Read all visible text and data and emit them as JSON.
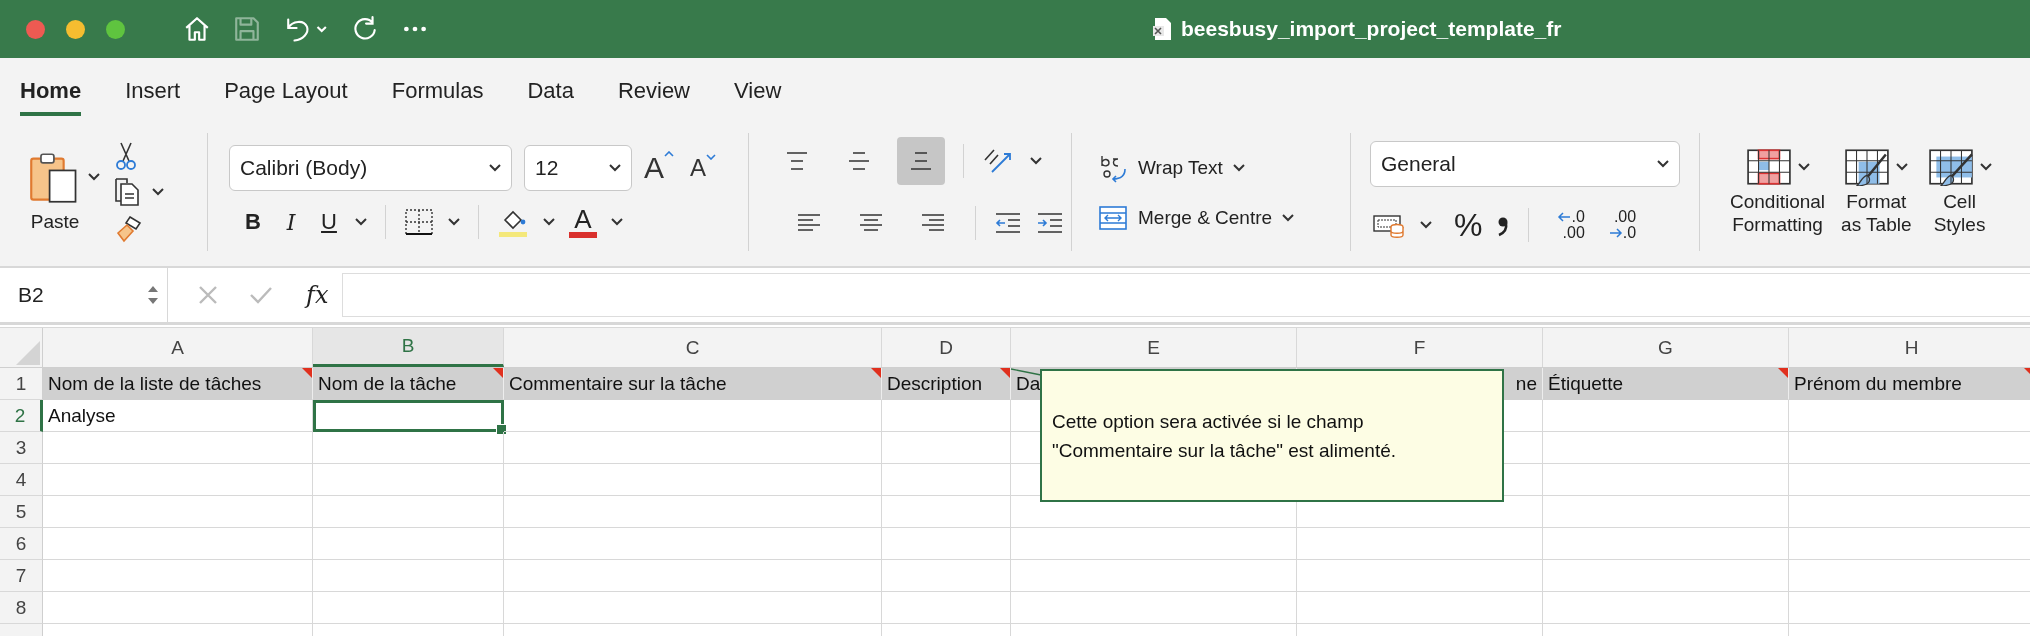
{
  "window": {
    "title": "beesbusy_import_project_template_fr"
  },
  "quick_access": [
    {
      "kind": "home",
      "disabled": false
    },
    {
      "kind": "save",
      "disabled": true
    },
    {
      "kind": "undo",
      "disabled": false
    },
    {
      "kind": "redo",
      "disabled": false
    },
    {
      "kind": "more",
      "disabled": false
    }
  ],
  "ribbon_tabs": [
    {
      "label": "Home",
      "selected": true
    },
    {
      "label": "Insert",
      "selected": false
    },
    {
      "label": "Page Layout",
      "selected": false
    },
    {
      "label": "Formulas",
      "selected": false
    },
    {
      "label": "Data",
      "selected": false
    },
    {
      "label": "Review",
      "selected": false
    },
    {
      "label": "View",
      "selected": false
    }
  ],
  "clipboard": {
    "paste_label": "Paste"
  },
  "font": {
    "family": "Calibri (Body)",
    "size": "12",
    "grow_glyph": "A",
    "shrink_glyph": "A",
    "style_buttons": [
      {
        "kind": "bold",
        "label": "B"
      },
      {
        "kind": "italic",
        "label": "I"
      },
      {
        "kind": "underline",
        "label": "U"
      }
    ],
    "color_buttons": [
      {
        "kind": "fill",
        "color": "#f4e87a"
      },
      {
        "kind": "text",
        "label": "A",
        "color": "#d9302c"
      }
    ]
  },
  "alignment": {
    "vertical": [
      {
        "kind": "top",
        "selected": false
      },
      {
        "kind": "middle",
        "selected": false
      },
      {
        "kind": "bottom",
        "selected": true
      }
    ],
    "horizontal": [
      {
        "kind": "left",
        "selected": false
      },
      {
        "kind": "center",
        "selected": false
      },
      {
        "kind": "right",
        "selected": false
      }
    ]
  },
  "wrap": {
    "wrap_label": "Wrap Text",
    "merge_label": "Merge & Centre"
  },
  "number": {
    "format": "General",
    "percent": "%",
    "decimal_buttons": [
      {
        "kind": "increase",
        "top": ".0",
        "bottom": ".00"
      },
      {
        "kind": "decrease",
        "top": ".00",
        "bottom": ".0"
      }
    ]
  },
  "styles": [
    {
      "kind": "conditional",
      "label": "Conditional\nFormatting"
    },
    {
      "kind": "table",
      "label": "Format\nas Table"
    },
    {
      "kind": "cell",
      "label": "Cell\nStyles"
    }
  ],
  "formula_bar": {
    "name_box": "B2",
    "fx": "fx"
  },
  "grid": {
    "columns": [
      {
        "label": "A",
        "selected": false
      },
      {
        "label": "B",
        "selected": true
      },
      {
        "label": "C",
        "selected": false
      },
      {
        "label": "D",
        "selected": false
      },
      {
        "label": "E",
        "selected": false
      },
      {
        "label": "F",
        "selected": false
      },
      {
        "label": "G",
        "selected": false
      },
      {
        "label": "H",
        "selected": false
      }
    ],
    "rows": [
      {
        "number": "1",
        "kind": "header",
        "selected": false,
        "cells": [
          {
            "text": "Nom de la liste de tâches",
            "note": true
          },
          {
            "text": "Nom de la tâche",
            "note": true
          },
          {
            "text": "Commentaire sur la tâche",
            "note": true
          },
          {
            "text": "Description",
            "note": true
          },
          {
            "text": "Da",
            "note": false
          },
          {
            "text": "ne",
            "note": false,
            "right_aligned": true
          },
          {
            "text": "Étiquette",
            "note": true
          },
          {
            "text": "Prénom du membre",
            "note": true
          }
        ]
      },
      {
        "number": "2",
        "kind": "data",
        "selected": true,
        "cells": [
          {
            "text": "Analyse",
            "note": false
          }
        ]
      },
      {
        "number": "3",
        "kind": "data",
        "selected": false,
        "cells": []
      },
      {
        "number": "4",
        "kind": "data",
        "selected": false,
        "cells": []
      },
      {
        "number": "5",
        "kind": "data",
        "selected": false,
        "cells": []
      },
      {
        "number": "6",
        "kind": "data",
        "selected": false,
        "cells": []
      },
      {
        "number": "7",
        "kind": "data",
        "selected": false,
        "cells": []
      },
      {
        "number": "8",
        "kind": "data",
        "selected": false,
        "cells": []
      }
    ]
  },
  "comment": {
    "text": "Cette option sera activée si le champ\n\"Commentaire sur la tâche\" est alimenté."
  }
}
